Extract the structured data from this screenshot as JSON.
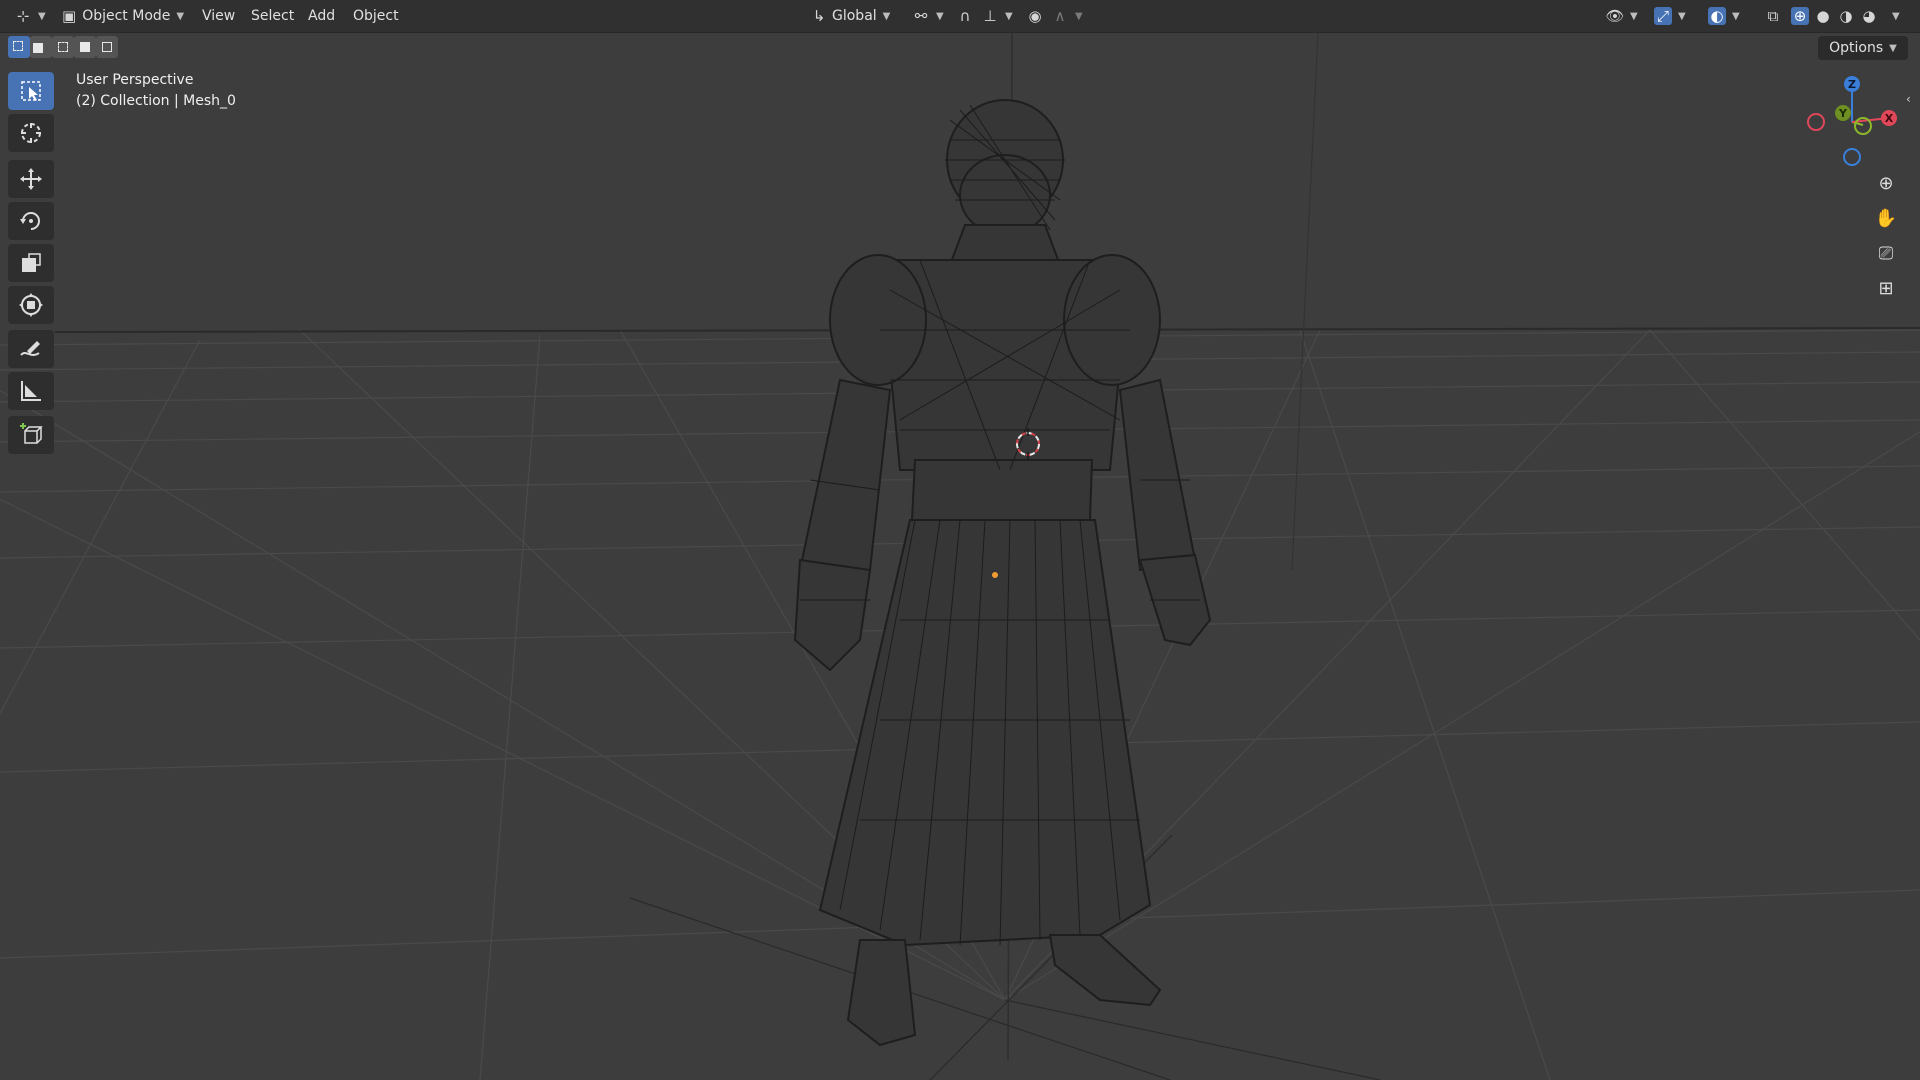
{
  "header": {
    "mode_label": "Object Mode",
    "menus": [
      "View",
      "Select",
      "Add",
      "Object"
    ],
    "transform_orientation": "Global"
  },
  "options_label": "Options",
  "viewport": {
    "view_name": "User Perspective",
    "collection_info": "(2) Collection | Mesh_0"
  },
  "gizmo": {
    "z": "Z",
    "y": "Y",
    "x": "X"
  },
  "colors": {
    "accent": "#4772b3",
    "background": "#3d3d3d",
    "header": "#303030",
    "axis_x": "#e0485a",
    "axis_y": "#8cb82a",
    "axis_z": "#3a7fd9"
  },
  "toolbar_icons": [
    "select-box-icon",
    "cursor-icon",
    "move-icon",
    "rotate-icon",
    "scale-icon",
    "transform-icon",
    "annotate-icon",
    "measure-icon",
    "add-cube-icon"
  ]
}
